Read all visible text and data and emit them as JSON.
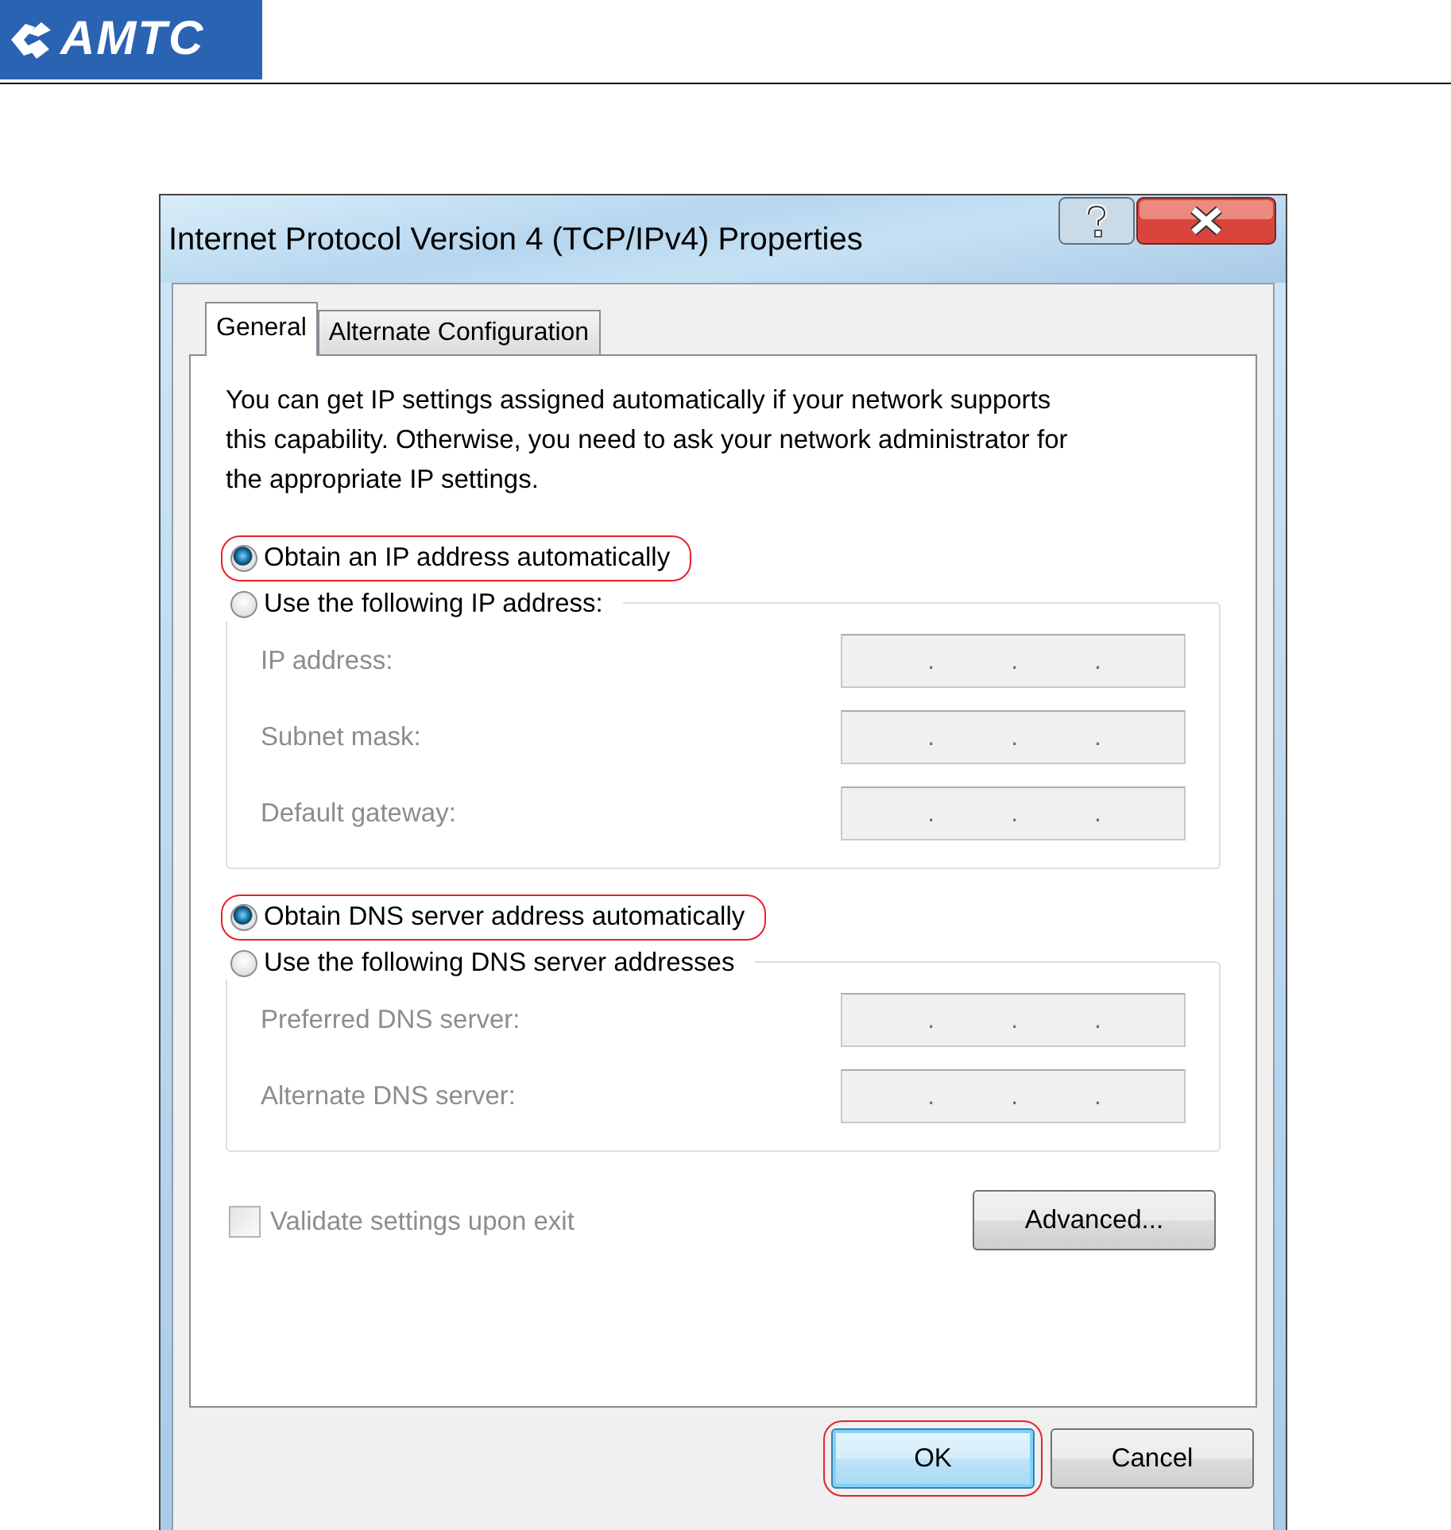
{
  "header": {
    "logo": "AMTC"
  },
  "window": {
    "title": "Internet Protocol Version 4 (TCP/IPv4) Properties"
  },
  "tabs": [
    {
      "label": "General",
      "selected": true
    },
    {
      "label": "Alternate Configuration",
      "selected": false
    }
  ],
  "description": "You can get IP settings assigned automatically if your network supports this capability. Otherwise, you need to ask your network administrator for the appropriate IP settings.",
  "sections": [
    {
      "auto_option": {
        "label": "Obtain an IP address automatically",
        "selected": true,
        "highlighted": true
      },
      "manual_option": {
        "label": "Use the following IP address:",
        "selected": false,
        "highlighted": false
      },
      "fields": [
        {
          "label": "IP address:",
          "disabled": true,
          "separators": [
            ".",
            ".",
            "."
          ]
        },
        {
          "label": "Subnet mask:",
          "disabled": true,
          "separators": [
            ".",
            ".",
            "."
          ]
        },
        {
          "label": "Default gateway:",
          "disabled": true,
          "separators": [
            ".",
            ".",
            "."
          ]
        }
      ]
    },
    {
      "auto_option": {
        "label": "Obtain DNS server address automatically",
        "selected": true,
        "highlighted": true
      },
      "manual_option": {
        "label": "Use the following DNS server addresses",
        "selected": false,
        "highlighted": false
      },
      "fields": [
        {
          "label": "Preferred DNS server:",
          "disabled": true,
          "separators": [
            ".",
            ".",
            "."
          ]
        },
        {
          "label": "Alternate DNS server:",
          "disabled": true,
          "separators": [
            ".",
            ".",
            "."
          ]
        }
      ]
    }
  ],
  "validate": {
    "label": "Validate settings upon exit",
    "checked": false,
    "disabled": true
  },
  "advanced_button": "Advanced...",
  "buttons": [
    {
      "label": "OK",
      "highlighted": true
    },
    {
      "label": "Cancel",
      "highlighted": false
    }
  ]
}
